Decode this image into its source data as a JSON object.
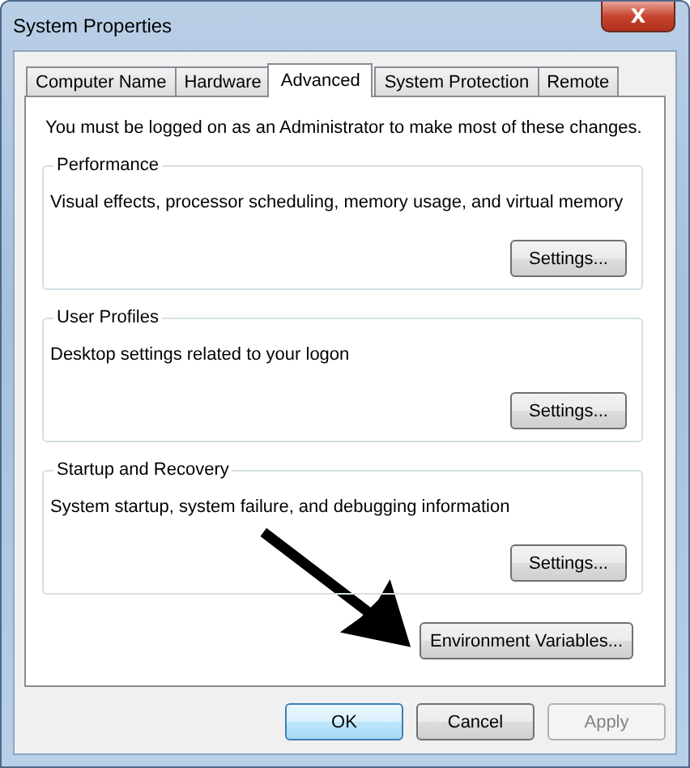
{
  "window": {
    "title": "System Properties",
    "close_glyph": "X"
  },
  "tabs": [
    {
      "label": "Computer Name",
      "selected": false
    },
    {
      "label": "Hardware",
      "selected": false
    },
    {
      "label": "Advanced",
      "selected": true
    },
    {
      "label": "System Protection",
      "selected": false
    },
    {
      "label": "Remote",
      "selected": false
    }
  ],
  "notice": "You must be logged on as an Administrator to make most of these changes.",
  "groups": [
    {
      "title": "Performance",
      "description": "Visual effects, processor scheduling, memory usage, and virtual memory",
      "button": "Settings..."
    },
    {
      "title": "User Profiles",
      "description": "Desktop settings related to your logon",
      "button": "Settings..."
    },
    {
      "title": "Startup and Recovery",
      "description": "System startup, system failure, and debugging information",
      "button": "Settings..."
    }
  ],
  "environment_button": "Environment Variables...",
  "buttons": [
    {
      "label": "OK",
      "default": true,
      "disabled": false
    },
    {
      "label": "Cancel",
      "default": false,
      "disabled": false
    },
    {
      "label": "Apply",
      "default": false,
      "disabled": true
    }
  ]
}
